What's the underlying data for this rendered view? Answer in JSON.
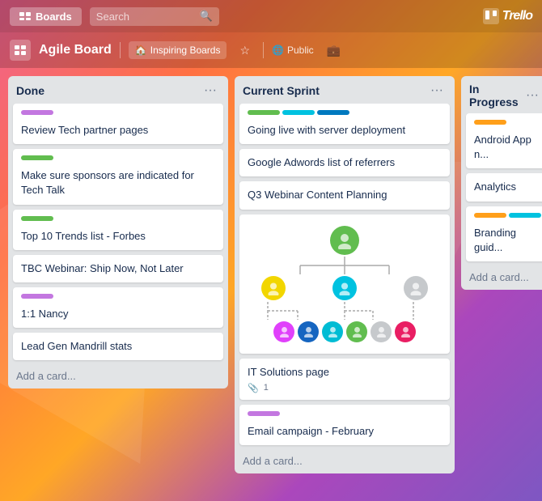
{
  "nav": {
    "boards_label": "Boards",
    "search_placeholder": "Search",
    "trello_label": "Trello"
  },
  "board_header": {
    "title": "Agile Board",
    "inspiring_label": "Inspiring Boards",
    "public_label": "Public",
    "star_label": "☆",
    "menu_label": "..."
  },
  "lists": [
    {
      "id": "done",
      "title": "Done",
      "cards": [
        {
          "id": "c1",
          "labels": [
            "purple"
          ],
          "title": "Review Tech partner pages"
        },
        {
          "id": "c2",
          "labels": [
            "green"
          ],
          "title": "Make sure sponsors are indicated for Tech Talk"
        },
        {
          "id": "c3",
          "labels": [
            "green"
          ],
          "title": "Top 10 Trends list - Forbes"
        },
        {
          "id": "c4",
          "labels": [],
          "title": "TBC Webinar: Ship Now, Not Later"
        },
        {
          "id": "c5",
          "labels": [
            "purple"
          ],
          "title": "1:1 Nancy"
        },
        {
          "id": "c6",
          "labels": [],
          "title": "Lead Gen Mandrill stats"
        }
      ],
      "add_label": "Add a card..."
    },
    {
      "id": "current-sprint",
      "title": "Current Sprint",
      "cards": [
        {
          "id": "c7",
          "labels": [
            "green",
            "teal",
            "blue"
          ],
          "title": "Going live with server deployment"
        },
        {
          "id": "c8",
          "labels": [],
          "title": "Google Adwords list of referrers"
        },
        {
          "id": "c9",
          "labels": [],
          "title": "Q3 Webinar Content Planning"
        },
        {
          "id": "c10",
          "labels": [],
          "title": "",
          "is_org_chart": true
        },
        {
          "id": "c11",
          "labels": [],
          "title": "IT Solutions page",
          "has_attachment": true,
          "attachment_count": "1"
        },
        {
          "id": "c12",
          "labels": [
            "purple"
          ],
          "title": "Email campaign - February"
        }
      ],
      "add_label": "Add a card..."
    }
  ],
  "in_progress": {
    "title": "In Progress",
    "cards": [
      {
        "id": "ip1",
        "labels": [
          "orange"
        ],
        "title": "Android App n..."
      },
      {
        "id": "ip2",
        "labels": [],
        "title": "Analytics"
      },
      {
        "id": "ip3",
        "labels": [
          "orange",
          "teal"
        ],
        "title": "Branding guid..."
      }
    ],
    "add_label": "Add a card..."
  },
  "org_chart": {
    "top_color": "#61bd4f",
    "mid_colors": [
      "#f2d600",
      "#00c2e0",
      "#c6c9cc"
    ],
    "bot_colors": [
      "#e040fb",
      "#1565c0",
      "#00bcd4",
      "#61bd4f",
      "#c6c9cc",
      "#e91e63"
    ]
  }
}
